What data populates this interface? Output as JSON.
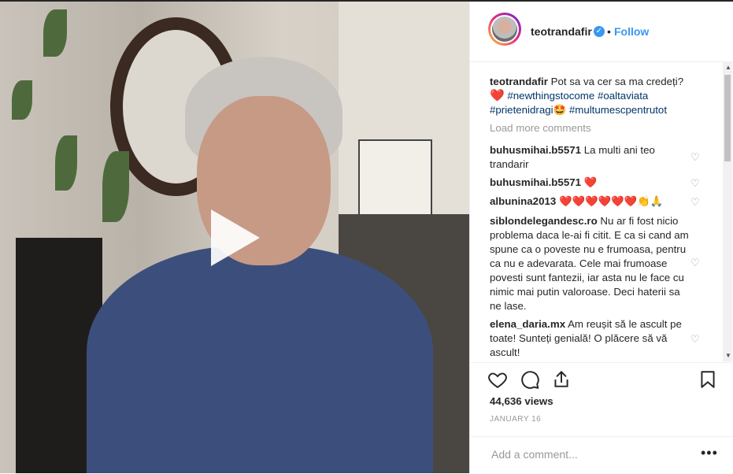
{
  "post": {
    "username": "teotrandafir",
    "follow_label": "Follow",
    "separator": "•",
    "verified_glyph": "✓"
  },
  "caption": {
    "user": "teotrandafir",
    "text": "Pot sa va cer sa ma credeți?",
    "emoji_heart": "❤️",
    "tags": [
      "#newthingstocome",
      "#oaltaviata",
      "#prietenidragi",
      "#multumescpentrutot"
    ],
    "emoji_face": "🤩"
  },
  "load_more": "Load more comments",
  "comments": [
    {
      "user": "buhusmihai.b5571",
      "text": "La multi ani teo trandarir"
    },
    {
      "user": "buhusmihai.b5571",
      "text": "❤️"
    },
    {
      "user": "albunina2013",
      "text": "❤️❤️❤️❤️❤️❤️👏🙏"
    },
    {
      "user": "siblondelegandesc.ro",
      "text": "Nu ar fi fost nicio problema daca le-ai fi citit. E ca si cand am spune ca o poveste nu e frumoasa, pentru ca nu e adevarata. Cele mai frumoase povesti sunt fantezii, iar asta nu le face cu nimic mai putin valoroase. Deci haterii sa ne lase."
    },
    {
      "user": "elena_daria.mx",
      "text": "Am reușit să le ascult pe toate! Sunteți genială! O plăcere să vă ascult!"
    }
  ],
  "stats": {
    "views": "44,636 views",
    "date": "JANUARY 16"
  },
  "add_comment": {
    "placeholder": "Add a comment..."
  },
  "more_glyph": "•••",
  "icons": {
    "like": "heart-outline-icon",
    "comment": "comment-bubble-icon",
    "share": "share-icon",
    "save": "bookmark-icon",
    "play": "play-icon"
  },
  "colors": {
    "accent": "#3897f0",
    "heart": "#ed4956",
    "hashtag": "#003569",
    "muted": "#999999"
  }
}
